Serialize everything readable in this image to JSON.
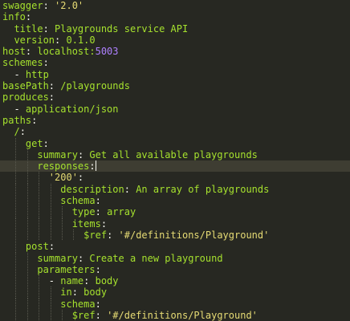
{
  "editor": {
    "colors": {
      "background": "#272822",
      "key": "#a6e22e",
      "string": "#e6db74",
      "number": "#ae81ff",
      "text": "#f8f8f2"
    },
    "lines": [
      {
        "indent": 0,
        "parts": [
          {
            "t": "swagger",
            "c": "key"
          },
          {
            "t": ": ",
            "c": "punc"
          },
          {
            "t": "'2.0'",
            "c": "str"
          }
        ]
      },
      {
        "indent": 0,
        "parts": [
          {
            "t": "info",
            "c": "key"
          },
          {
            "t": ":",
            "c": "punc"
          }
        ]
      },
      {
        "indent": 1,
        "parts": [
          {
            "t": "title",
            "c": "key"
          },
          {
            "t": ": ",
            "c": "punc"
          },
          {
            "t": "Playgrounds service API",
            "c": "key"
          }
        ]
      },
      {
        "indent": 1,
        "parts": [
          {
            "t": "version",
            "c": "key"
          },
          {
            "t": ": ",
            "c": "punc"
          },
          {
            "t": "0.1.0",
            "c": "key"
          }
        ]
      },
      {
        "indent": 0,
        "parts": [
          {
            "t": "host",
            "c": "key"
          },
          {
            "t": ": ",
            "c": "punc"
          },
          {
            "t": "localhost:",
            "c": "key"
          },
          {
            "t": "5003",
            "c": "num"
          }
        ]
      },
      {
        "indent": 0,
        "parts": [
          {
            "t": "schemes",
            "c": "key"
          },
          {
            "t": ":",
            "c": "punc"
          }
        ]
      },
      {
        "indent": 1,
        "parts": [
          {
            "t": "- ",
            "c": "punc"
          },
          {
            "t": "http",
            "c": "key"
          }
        ]
      },
      {
        "indent": 0,
        "parts": [
          {
            "t": "basePath",
            "c": "key"
          },
          {
            "t": ": ",
            "c": "punc"
          },
          {
            "t": "/playgrounds",
            "c": "key"
          }
        ]
      },
      {
        "indent": 0,
        "parts": [
          {
            "t": "produces",
            "c": "key"
          },
          {
            "t": ":",
            "c": "punc"
          }
        ]
      },
      {
        "indent": 1,
        "parts": [
          {
            "t": "- ",
            "c": "punc"
          },
          {
            "t": "application/json",
            "c": "key"
          }
        ]
      },
      {
        "indent": 0,
        "parts": [
          {
            "t": "paths",
            "c": "key"
          },
          {
            "t": ":",
            "c": "punc"
          }
        ]
      },
      {
        "indent": 1,
        "parts": [
          {
            "t": "/",
            "c": "key"
          },
          {
            "t": ":",
            "c": "punc"
          }
        ]
      },
      {
        "indent": 2,
        "parts": [
          {
            "t": "get",
            "c": "key"
          },
          {
            "t": ":",
            "c": "punc"
          }
        ]
      },
      {
        "indent": 3,
        "parts": [
          {
            "t": "summary",
            "c": "key"
          },
          {
            "t": ": ",
            "c": "punc"
          },
          {
            "t": "Get all available playgrounds",
            "c": "key"
          }
        ]
      },
      {
        "indent": 3,
        "current": true,
        "cursor": true,
        "parts": [
          {
            "t": "responses",
            "c": "key"
          },
          {
            "t": ":",
            "c": "punc"
          }
        ]
      },
      {
        "indent": 4,
        "parts": [
          {
            "t": "'200'",
            "c": "str"
          },
          {
            "t": ":",
            "c": "punc"
          }
        ]
      },
      {
        "indent": 5,
        "parts": [
          {
            "t": "description",
            "c": "key"
          },
          {
            "t": ": ",
            "c": "punc"
          },
          {
            "t": "An array of playgrounds",
            "c": "key"
          }
        ]
      },
      {
        "indent": 5,
        "parts": [
          {
            "t": "schema",
            "c": "key"
          },
          {
            "t": ":",
            "c": "punc"
          }
        ]
      },
      {
        "indent": 6,
        "parts": [
          {
            "t": "type",
            "c": "key"
          },
          {
            "t": ": ",
            "c": "punc"
          },
          {
            "t": "array",
            "c": "key"
          }
        ]
      },
      {
        "indent": 6,
        "parts": [
          {
            "t": "items",
            "c": "key"
          },
          {
            "t": ":",
            "c": "punc"
          }
        ]
      },
      {
        "indent": 7,
        "parts": [
          {
            "t": "$ref",
            "c": "key"
          },
          {
            "t": ": ",
            "c": "punc"
          },
          {
            "t": "'#/definitions/Playground'",
            "c": "str"
          }
        ]
      },
      {
        "indent": 2,
        "parts": [
          {
            "t": "post",
            "c": "key"
          },
          {
            "t": ":",
            "c": "punc"
          }
        ]
      },
      {
        "indent": 3,
        "parts": [
          {
            "t": "summary",
            "c": "key"
          },
          {
            "t": ": ",
            "c": "punc"
          },
          {
            "t": "Create a new playground",
            "c": "key"
          }
        ]
      },
      {
        "indent": 3,
        "parts": [
          {
            "t": "parameters",
            "c": "key"
          },
          {
            "t": ":",
            "c": "punc"
          }
        ]
      },
      {
        "indent": 4,
        "parts": [
          {
            "t": "- ",
            "c": "punc"
          },
          {
            "t": "name",
            "c": "key"
          },
          {
            "t": ": ",
            "c": "punc"
          },
          {
            "t": "body",
            "c": "key"
          }
        ]
      },
      {
        "indent": 5,
        "parts": [
          {
            "t": "in",
            "c": "key"
          },
          {
            "t": ": ",
            "c": "punc"
          },
          {
            "t": "body",
            "c": "key"
          }
        ]
      },
      {
        "indent": 5,
        "parts": [
          {
            "t": "schema",
            "c": "key"
          },
          {
            "t": ":",
            "c": "punc"
          }
        ]
      },
      {
        "indent": 6,
        "parts": [
          {
            "t": "$ref",
            "c": "key"
          },
          {
            "t": ": ",
            "c": "punc"
          },
          {
            "t": "'#/definitions/Playground'",
            "c": "str"
          }
        ]
      }
    ]
  }
}
